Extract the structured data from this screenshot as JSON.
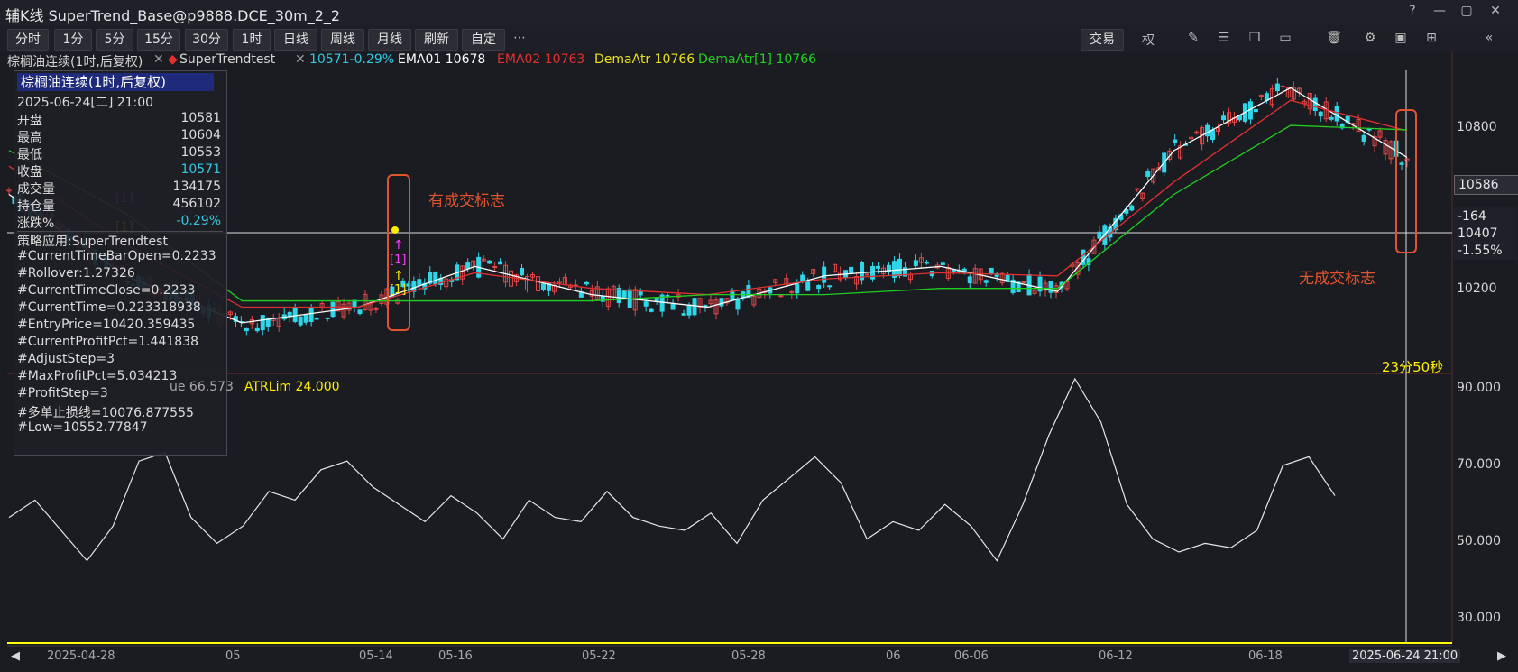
{
  "window": {
    "title": "辅K线 SuperTrend_Base@p9888.DCE_30m_2_2",
    "controls": [
      "?",
      "—",
      "▢",
      "✕"
    ]
  },
  "toolbar": {
    "periods": [
      "分时",
      "1分",
      "5分",
      "15分",
      "30分",
      "1时",
      "日线",
      "周线",
      "月线",
      "刷新",
      "自定"
    ],
    "more": "⋯",
    "trade": "交易",
    "quan": "权",
    "icons": [
      "pen-icon",
      "sliders-icon",
      "copy-icon",
      "window-icon",
      "trash-icon",
      "gear-icon",
      "image-icon",
      "pin-icon",
      "collapse-icon"
    ]
  },
  "legend": {
    "symbol": "棕榈油连续(1时,后复权)",
    "strategy": "SuperTrendtest",
    "price": "10571-0.29%",
    "ema01": "EMA01 10678",
    "ema02": "EMA02 10763",
    "dema": "DemaAtr 10766",
    "dema1": "DemaAtr[1] 10766",
    "colors": {
      "price": "#2ec8e0",
      "ema01": "#ffffff",
      "ema02": "#e03030",
      "dema": "#e8e020",
      "dema1": "#20d020"
    }
  },
  "infobox": {
    "header": "棕榈油连续(1时,后复权)",
    "datetime": "2025-06-24[二] 21:00",
    "rows": [
      {
        "k": "开盘",
        "v": "10581"
      },
      {
        "k": "最高",
        "v": "10604"
      },
      {
        "k": "最低",
        "v": "10553"
      },
      {
        "k": "收盘",
        "v": "10571"
      },
      {
        "k": "成交量",
        "v": "134175"
      },
      {
        "k": "持仓量",
        "v": "456102"
      },
      {
        "k": "涨跌%",
        "v": "-0.29%"
      }
    ],
    "strategy_lines": [
      "策略应用:SuperTrendtest",
      "#CurrentTimeBarOpen=0.2233",
      "#Rollover:1.27326",
      "#CurrentTimeClose=0.2233",
      "#CurrentTime=0.223318938",
      "#EntryPrice=10420.359435",
      "#CurrentProfitPct=1.441838",
      "#AdjustStep=3",
      "#MaxProfitPct=5.034213",
      "#ProfitStep=3",
      "#多单止损线=10076.877555",
      "#Low=10552.77847"
    ]
  },
  "annotations": {
    "trade_mark": "有成交标志",
    "no_trade_mark": "无成交标志",
    "countdown": "23分50秒"
  },
  "price_axis": {
    "labels": [
      "10800",
      "10200"
    ],
    "last_price": "10586",
    "crosshair_price": "10407",
    "crosshair_change": "-164",
    "crosshair_pct": "-1.55%"
  },
  "sub_chart": {
    "partial_label": "ue 66.573",
    "atr_label": "ATRLim 24.000",
    "axis_labels": [
      "90.000",
      "70.000",
      "50.000",
      "30.000"
    ]
  },
  "date_axis": {
    "labels": [
      "2025-04-28",
      "05",
      "05-14",
      "05-16",
      "05-22",
      "05-28",
      "06",
      "06-06",
      "06-12",
      "06-18",
      "2025-06-24 21:00"
    ]
  },
  "chart_data": {
    "type": "line",
    "title": "",
    "series": [
      {
        "name": "EMA01",
        "x": [
          0,
          10,
          20,
          30,
          40,
          50,
          60,
          70,
          80,
          90,
          100,
          110,
          120
        ],
        "values": [
          10560,
          10300,
          10150,
          10200,
          10330,
          10240,
          10200,
          10300,
          10330,
          10250,
          10700,
          10900,
          10678
        ]
      },
      {
        "name": "EMA02",
        "x": [
          0,
          10,
          20,
          30,
          40,
          50,
          60,
          70,
          80,
          90,
          100,
          110,
          120
        ],
        "values": [
          10650,
          10400,
          10200,
          10200,
          10310,
          10260,
          10240,
          10290,
          10310,
          10300,
          10600,
          10860,
          10763
        ]
      },
      {
        "name": "DemaAtr",
        "x": [
          0,
          10,
          20,
          30,
          40,
          50,
          60,
          70,
          80,
          90,
          100,
          110,
          120
        ],
        "values": [
          10700,
          10500,
          10220,
          10220,
          10220,
          10220,
          10240,
          10240,
          10260,
          10260,
          10560,
          10780,
          10766
        ]
      }
    ],
    "sub_series": {
      "name": "ATRLim",
      "limit": 24.0,
      "ylim": [
        30,
        90
      ],
      "values": [
        58,
        62,
        55,
        48,
        56,
        71,
        73,
        58,
        52,
        56,
        64,
        62,
        69,
        71,
        65,
        61,
        57,
        63,
        59,
        53,
        62,
        58,
        57,
        64,
        58,
        56,
        55,
        59,
        52,
        62,
        67,
        72,
        66,
        53,
        57,
        55,
        61,
        56,
        48,
        61,
        77,
        90,
        80,
        61,
        53,
        50,
        52,
        51,
        55,
        70,
        72,
        63
      ]
    },
    "ylim": [
      10000,
      10950
    ]
  }
}
